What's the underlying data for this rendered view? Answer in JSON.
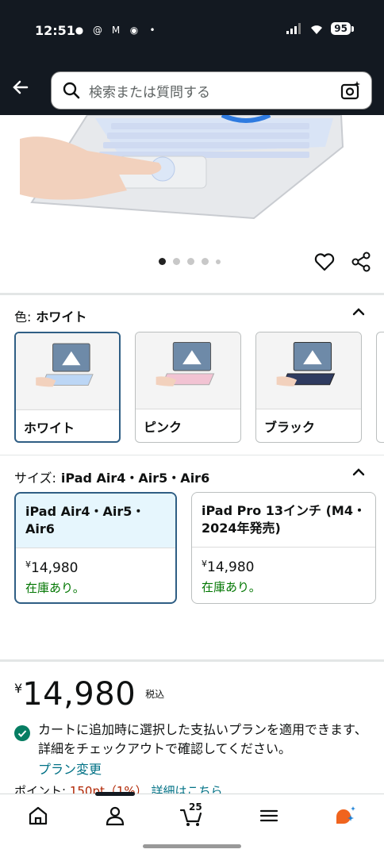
{
  "status_bar": {
    "time": "12:51",
    "battery": "95"
  },
  "search": {
    "placeholder": "検索または質問する"
  },
  "color_section": {
    "label": "色:",
    "selected": "ホワイト",
    "options": [
      {
        "name": "ホワイト",
        "key_color": "#bcd6f5"
      },
      {
        "name": "ピンク",
        "key_color": "#f2c3d3"
      },
      {
        "name": "ブラック",
        "key_color": "#2f3b60"
      }
    ]
  },
  "size_section": {
    "label": "サイズ:",
    "selected": "iPad Air4・Air5・Air6",
    "options": [
      {
        "title": "iPad Air4・Air5・Air6",
        "price": "14,980",
        "stock": "在庫あり。"
      },
      {
        "title": "iPad Pro 13インチ (M4・2024年発売)",
        "price": "14,980",
        "stock": "在庫あり。"
      }
    ]
  },
  "price": {
    "currency": "¥",
    "amount": "14,980",
    "tax": "税込"
  },
  "plan": {
    "text": "カートに追加時に選択した支払いプランを適用できます、詳細をチェックアウトで確認してください。",
    "link": "プラン変更"
  },
  "points": {
    "label": "ポイント:",
    "value": "150pt（1%）",
    "link": "詳細はこちら"
  },
  "nav": {
    "cart_count": "25"
  },
  "colors": {
    "header_bg": "#131921",
    "link": "#007185",
    "stock": "#007600",
    "selected_border": "#2f5e84"
  }
}
